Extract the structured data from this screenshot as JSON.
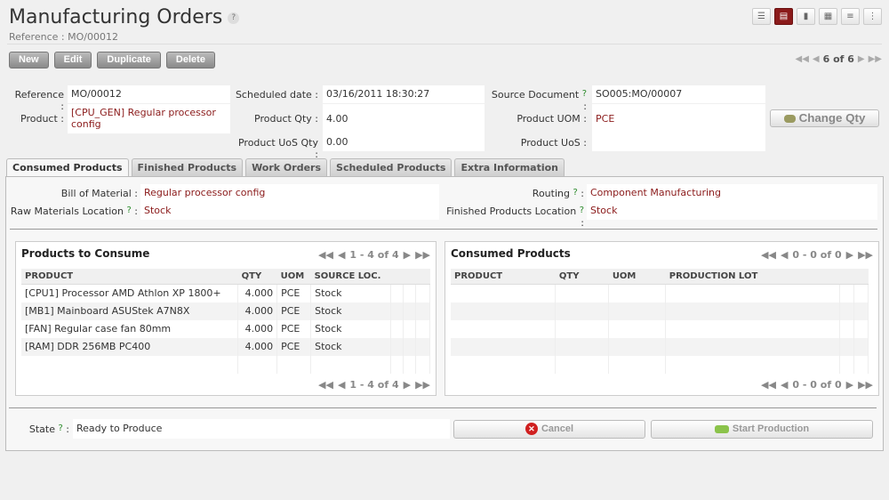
{
  "page": {
    "title": "Manufacturing Orders",
    "help_mark": "?",
    "subtitle": "Reference : MO/00012"
  },
  "views": [
    "list-view-icon",
    "form-view-icon",
    "graph-view-icon",
    "calendar-view-icon",
    "gantt-view-icon",
    "diagram-view-icon"
  ],
  "actions": {
    "new": "New",
    "edit": "Edit",
    "duplicate": "Duplicate",
    "delete": "Delete"
  },
  "pager": {
    "text": "6 of 6"
  },
  "form": {
    "reference_label": "Reference :",
    "reference_value": "MO/00012",
    "product_label": "Product :",
    "product_value": "[CPU_GEN] Regular processor config",
    "scheduled_date_label": "Scheduled date :",
    "scheduled_date_value": "03/16/2011 18:30:27",
    "product_qty_label": "Product Qty :",
    "product_qty_value": "4.00",
    "product_uos_qty_label": "Product UoS Qty :",
    "product_uos_qty_value": "0.00",
    "source_document_label": "Source Document",
    "source_document_value": "SO005:MO/00007",
    "product_uom_label": "Product UOM :",
    "product_uom_value": "PCE",
    "product_uos_label": "Product UoS :",
    "product_uos_value": "",
    "change_qty": "Change Qty"
  },
  "tabs": [
    "Consumed Products",
    "Finished Products",
    "Work Orders",
    "Scheduled Products",
    "Extra Information"
  ],
  "tab_content": {
    "bom_label": "Bill of Material :",
    "bom_value": "Regular processor config",
    "raw_location_label": "Raw Materials Location",
    "raw_location_value": "Stock",
    "routing_label": "Routing",
    "routing_value": "Component Manufacturing",
    "finished_location_label": "Finished Products Location",
    "finished_location_value": "Stock"
  },
  "to_consume": {
    "title": "Products to Consume",
    "pager": "1 - 4 of 4",
    "columns": [
      "PRODUCT",
      "QTY",
      "UOM",
      "SOURCE LOC."
    ],
    "rows": [
      {
        "product": "[CPU1] Processor AMD Athlon XP 1800+",
        "qty": "4.000",
        "uom": "PCE",
        "loc": "Stock"
      },
      {
        "product": "[MB1] Mainboard ASUStek A7N8X",
        "qty": "4.000",
        "uom": "PCE",
        "loc": "Stock"
      },
      {
        "product": "[FAN] Regular case fan 80mm",
        "qty": "4.000",
        "uom": "PCE",
        "loc": "Stock"
      },
      {
        "product": "[RAM] DDR 256MB PC400",
        "qty": "4.000",
        "uom": "PCE",
        "loc": "Stock"
      }
    ]
  },
  "consumed": {
    "title": "Consumed Products",
    "pager": "0 - 0 of 0",
    "columns": [
      "PRODUCT",
      "QTY",
      "UOM",
      "PRODUCTION LOT"
    ]
  },
  "footer": {
    "state_label": "State",
    "state_value": "Ready to Produce",
    "cancel": "Cancel",
    "start": "Start Production"
  },
  "colors": {
    "accent": "#8b1b1b",
    "help": "#2a8a2a"
  }
}
